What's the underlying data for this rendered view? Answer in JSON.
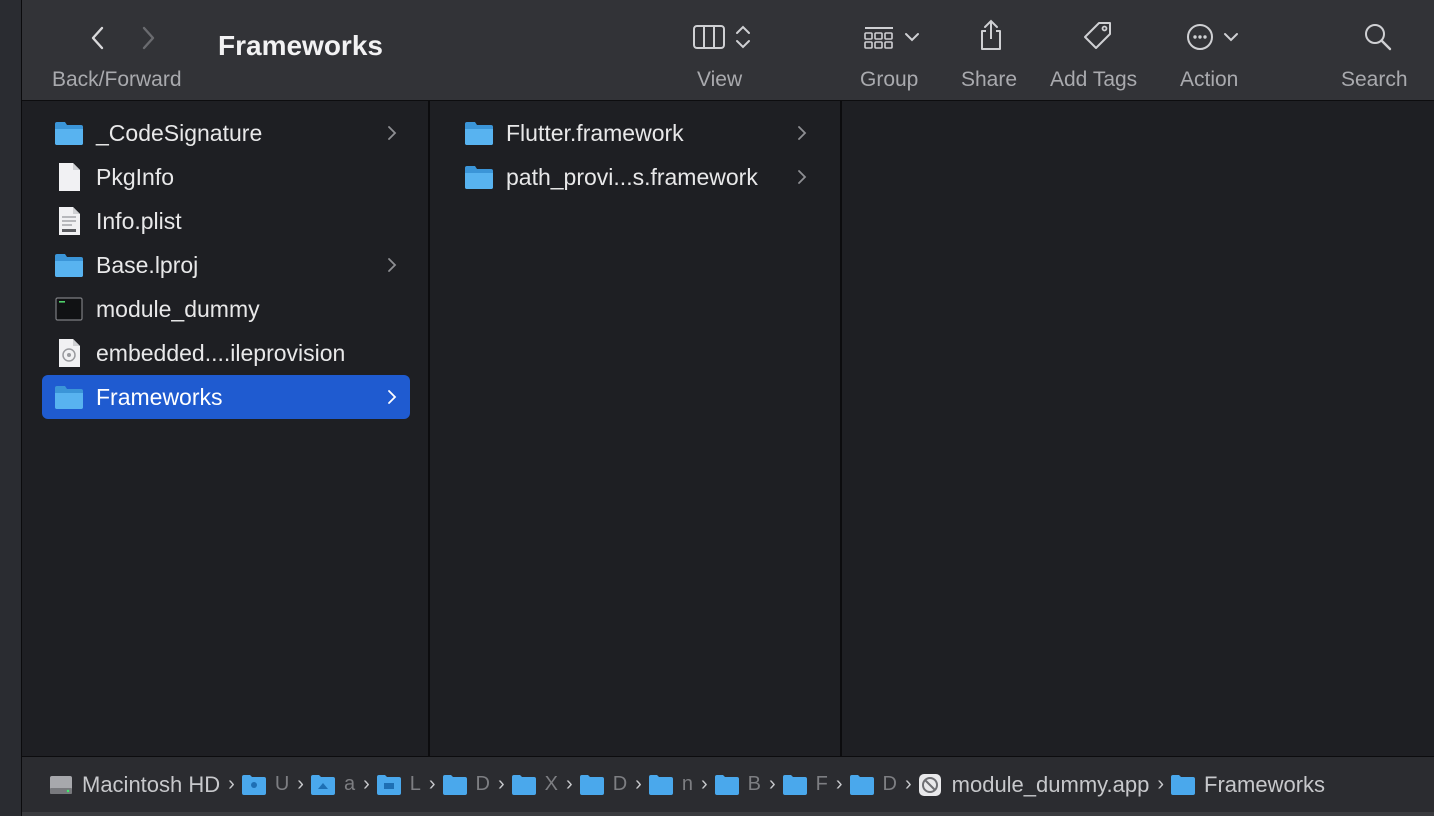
{
  "window": {
    "title": "Frameworks"
  },
  "toolbar": {
    "back_forward_label": "Back/Forward",
    "view_label": "View",
    "group_label": "Group",
    "share_label": "Share",
    "add_tags_label": "Add Tags",
    "action_label": "Action",
    "search_label": "Search"
  },
  "column1": {
    "items": [
      {
        "name": "_CodeSignature",
        "icon": "folder-icon"
      },
      {
        "name": "PkgInfo",
        "icon": "document-icon"
      },
      {
        "name": "Info.plist",
        "icon": "plist-file-icon"
      },
      {
        "name": "Base.lproj",
        "icon": "folder-icon"
      },
      {
        "name": "module_dummy",
        "icon": "terminal-exec-icon"
      },
      {
        "name": "embedded....ileprovision",
        "icon": "provision-file-icon"
      },
      {
        "name": "Frameworks",
        "icon": "folder-icon",
        "selected": true
      }
    ]
  },
  "column2": {
    "items": [
      {
        "name": "Flutter.framework",
        "icon": "folder-icon"
      },
      {
        "name": "path_provi...s.framework",
        "icon": "folder-icon"
      }
    ]
  },
  "pathbar": {
    "crumbs": [
      {
        "label": "Macintosh HD",
        "icon": "hard-drive-icon"
      },
      {
        "label": "U",
        "icon": "users-folder-icon"
      },
      {
        "label": "a",
        "icon": "home-folder-icon"
      },
      {
        "label": "L",
        "icon": "library-folder-icon"
      },
      {
        "label": "D",
        "icon": "folder-icon"
      },
      {
        "label": "X",
        "icon": "folder-icon"
      },
      {
        "label": "D",
        "icon": "folder-icon"
      },
      {
        "label": "n",
        "icon": "folder-icon"
      },
      {
        "label": "B",
        "icon": "folder-icon"
      },
      {
        "label": "F",
        "icon": "folder-icon"
      },
      {
        "label": "D",
        "icon": "folder-icon"
      },
      {
        "label": "module_dummy.app",
        "icon": "app-blocked-icon"
      },
      {
        "label": "Frameworks",
        "icon": "folder-icon"
      }
    ]
  },
  "colors": {
    "toolbar_bg": "#323337",
    "content_bg": "#1e1f23",
    "selection": "#1f5bd0",
    "folder_blue": "#4aa8ec"
  }
}
